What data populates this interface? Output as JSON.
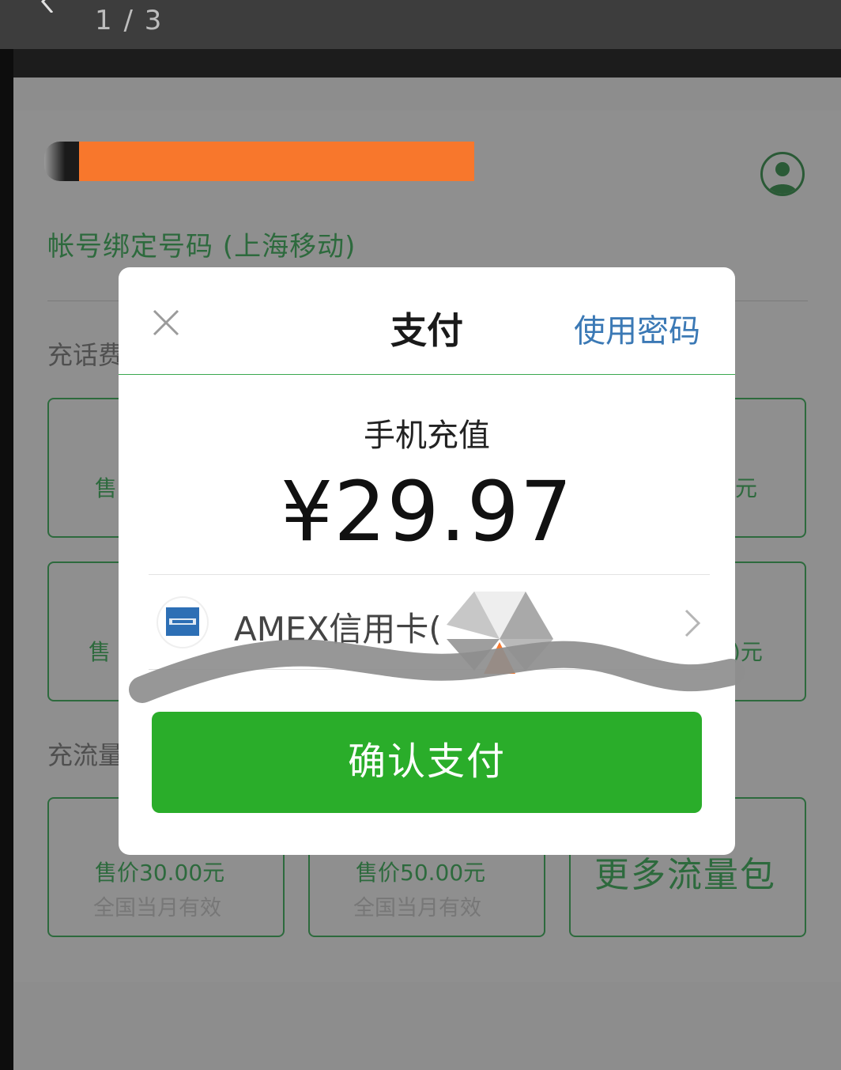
{
  "viewer": {
    "page_indicator": "1 / 3"
  },
  "background_page": {
    "bound_number_label": "帐号绑定号码 (上海移动)",
    "recharge_fee_label": "充话费",
    "recharge_data_label": "充流量",
    "tile_price_left_1": "售",
    "tile_price_right_1": "元",
    "tile_price_left_2": "售",
    "tile_price_right_2": ")元",
    "data_tiles": [
      {
        "price": "售价30.00元",
        "validity": "全国当月有效"
      },
      {
        "price": "售价50.00元",
        "validity": "全国当月有效"
      }
    ],
    "more_data_label": "更多流量包"
  },
  "dialog": {
    "title": "支付",
    "password_link": "使用密码",
    "description": "手机充值",
    "amount": "¥29.97",
    "payment_method": "AMEX信用卡(",
    "confirm_button": "确认支付"
  },
  "colors": {
    "confirm_green": "#2aad2a",
    "link_blue": "#3b79b5",
    "redaction_orange": "#f8772c",
    "wechat_green_dim": "#2d6a3d"
  },
  "icons": {
    "close": "close-icon",
    "back": "back-arrow-icon",
    "avatar": "user-avatar-icon",
    "card": "amex-card-icon",
    "chevron": "chevron-right-icon"
  }
}
